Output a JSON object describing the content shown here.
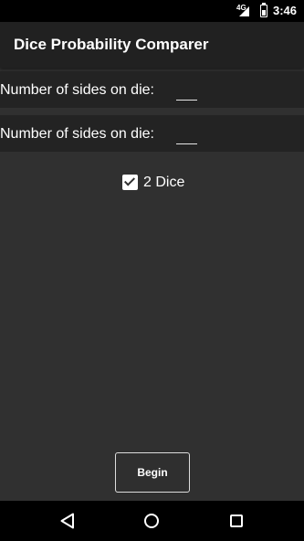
{
  "status_bar": {
    "network": "4G",
    "time": "3:46",
    "icons": [
      "signal-icon",
      "battery-icon"
    ]
  },
  "app_bar": {
    "title": "Dice Probability Comparer"
  },
  "die_rows": [
    {
      "label": "Number of sides on die:",
      "value": ""
    },
    {
      "label": "Number of sides on die:",
      "value": ""
    }
  ],
  "two_dice": {
    "label": "2 Dice",
    "checked": true
  },
  "begin_button": {
    "label": "Begin"
  },
  "nav_bar": {
    "icons": [
      "back-icon",
      "home-icon",
      "recent-apps-icon"
    ]
  },
  "colors": {
    "background": "#303030",
    "app_bar": "#212121",
    "row_background": "#232323",
    "system_bars": "#000000",
    "text": "#ffffff"
  }
}
